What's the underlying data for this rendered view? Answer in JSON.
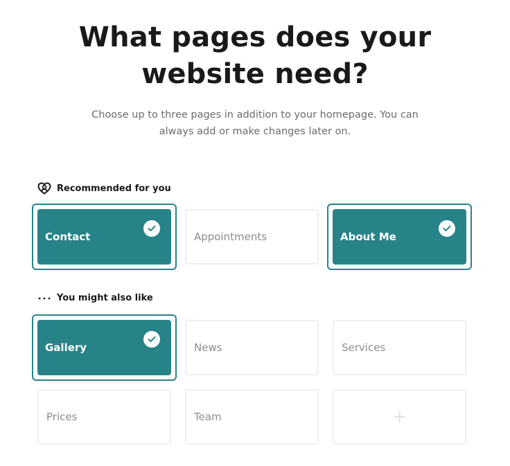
{
  "header": {
    "title_line1": "What pages does your",
    "title_line2": "website need?",
    "subtitle_line1": "Choose up to three pages in addition to your homepage. You can",
    "subtitle_line2": "always add or make changes later on."
  },
  "sections": {
    "recommended": {
      "icon": "heart-person-icon",
      "label": "Recommended for you",
      "cards": [
        {
          "label": "Contact",
          "selected": true
        },
        {
          "label": "Appointments",
          "selected": false
        },
        {
          "label": "About Me",
          "selected": true
        }
      ]
    },
    "also_like": {
      "icon": "more-dots-icon",
      "label": "You might also like",
      "cards": [
        {
          "label": "Gallery",
          "selected": true
        },
        {
          "label": "News",
          "selected": false
        },
        {
          "label": "Services",
          "selected": false
        },
        {
          "label": "Prices",
          "selected": false
        },
        {
          "label": "Team",
          "selected": false
        },
        {
          "label": "+",
          "selected": false,
          "icon": "plus-icon"
        }
      ]
    }
  },
  "colors": {
    "accent": "#288388",
    "card_border": "#efefef",
    "muted_text": "#8c8c8c"
  }
}
